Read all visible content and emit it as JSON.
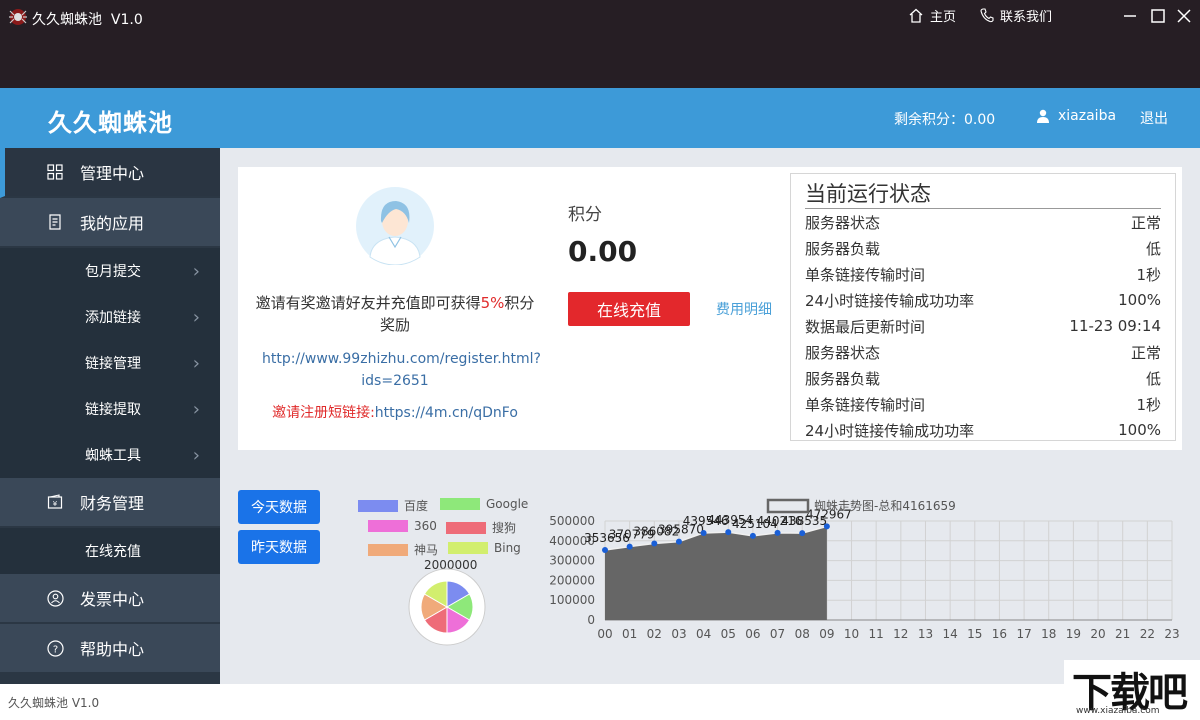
{
  "titlebar": {
    "app_title": "久久蜘蛛池",
    "version": "V1.0",
    "home_label": "主页",
    "contact_label": "联系我们"
  },
  "header": {
    "brand": "久久蜘蛛池",
    "points_label": "剩余积分：",
    "points_value": "0.00",
    "username": "xiazaiba",
    "logout_label": "退出"
  },
  "sidebar": {
    "items": [
      {
        "label": "管理中心",
        "icon": "grid-icon"
      },
      {
        "label": "我的应用",
        "icon": "document-icon"
      },
      {
        "label": "包月提交"
      },
      {
        "label": "添加链接"
      },
      {
        "label": "链接管理"
      },
      {
        "label": "链接提取"
      },
      {
        "label": "蜘蛛工具"
      },
      {
        "label": "财务管理",
        "icon": "wallet-icon"
      },
      {
        "label": "在线充值"
      },
      {
        "label": "发票中心",
        "icon": "user-circle-icon"
      },
      {
        "label": "帮助中心",
        "icon": "help-icon"
      }
    ]
  },
  "profile": {
    "invite_text_1": "邀请有奖邀请好友并充值即可获得",
    "invite_highlight": "5%",
    "invite_text_2": "积分奖励",
    "register_url_line1": "http://www.99zhizhu.com/register.html?",
    "register_url_line2": "ids=2651",
    "short_link_label": "邀请注册短链接:",
    "short_link_url": "https://4m.cn/qDnFo"
  },
  "points": {
    "label": "积分",
    "value": "0.00",
    "recharge_button": "在线充值",
    "fee_link": "费用明细"
  },
  "status": {
    "title": "当前运行状态",
    "rows": [
      {
        "label": "服务器状态",
        "value": "正常"
      },
      {
        "label": "服务器负载",
        "value": "低"
      },
      {
        "label": "单条链接传输时间",
        "value": "1秒"
      },
      {
        "label": "24小时链接传输成功功率",
        "value": "100%"
      },
      {
        "label": "数据最后更新时间",
        "value": "11-23 09:14"
      },
      {
        "label": "服务器状态",
        "value": "正常"
      },
      {
        "label": "服务器负载",
        "value": "低"
      },
      {
        "label": "单条链接传输时间",
        "value": "1秒"
      },
      {
        "label": "24小时链接传输成功功率",
        "value": "100%"
      }
    ]
  },
  "buttons": {
    "today": "今天数据",
    "yesterday": "昨天数据"
  },
  "footer": {
    "text": "久久蜘蛛池   V1.0"
  },
  "watermark": {
    "big": "下载吧",
    "small": "www.xiazaiba.com"
  },
  "chart_data": [
    {
      "type": "pie",
      "title": "2000000",
      "labels": [
        "百度",
        "Google",
        "360",
        "搜狗",
        "神马",
        "Bing"
      ],
      "colors": [
        "#7c8cf0",
        "#8ee87a",
        "#ee6fd8",
        "#ee6c78",
        "#f0aa7a",
        "#d2ee6e"
      ],
      "values": [
        1,
        1,
        1,
        1,
        1,
        1
      ]
    },
    {
      "type": "area",
      "legend": "蜘蛛走势图-总和4161659",
      "x": [
        "00",
        "01",
        "02",
        "03",
        "04",
        "05",
        "06",
        "07",
        "08",
        "09",
        "10",
        "11",
        "12",
        "13",
        "14",
        "15",
        "16",
        "17",
        "18",
        "19",
        "20",
        "21",
        "22",
        "23"
      ],
      "values": [
        353656,
        370779,
        386082,
        395870,
        439546,
        443954,
        425104,
        440216,
        438535,
        472967
      ],
      "ylim": [
        0,
        500000
      ],
      "yticks": [
        "500000",
        "400000",
        "300000",
        "200000",
        "100000",
        "0"
      ],
      "grid": true,
      "fill_color": "#666666",
      "point_color": "#1a5fd6"
    }
  ]
}
